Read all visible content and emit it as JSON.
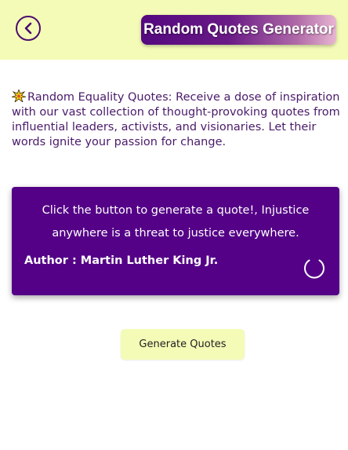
{
  "header": {
    "title": "Random Quotes Generator",
    "back_icon": "chevron-left-circle-icon"
  },
  "intro": {
    "icon": "sparkle-icon",
    "text": "Random Equality Quotes: Receive a dose of inspiration with our vast collection of thought-provoking quotes from influential leaders, activists, and visionaries. Let their words ignite your passion for change."
  },
  "quote": {
    "text": "Click the button to generate a quote!, Injustice anywhere is a threat to justice everywhere.",
    "author": "Author : Martin Luther King Jr."
  },
  "actions": {
    "generate_label": "Generate Quotes"
  },
  "colors": {
    "header_bg": "#f4fbb6",
    "card_bg": "#540187",
    "text_purple": "#4a1a6a",
    "button_bg": "#f4fbb6"
  }
}
